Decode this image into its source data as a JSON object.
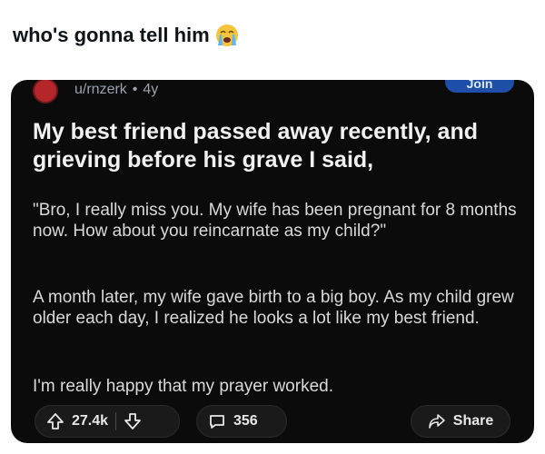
{
  "tweet": {
    "text": "who's gonna tell him",
    "emoji": "crying-face"
  },
  "post": {
    "author": "u/rnzerk",
    "separator": "•",
    "age": "4y",
    "join_label": "Join",
    "title": "My best friend passed away recently, and grieving before his grave I said,",
    "paragraphs": [
      "\"Bro, I really miss you. My wife has been pregnant for 8 months now. How about you reincarnate as my child?\"",
      "A month later, my wife gave birth to a big boy. As my child grew older each day, I realized he looks a lot like my best friend.",
      "I'm really happy that my prayer worked."
    ],
    "upvotes": "27.4k",
    "comments": "356",
    "share_label": "Share"
  },
  "colors": {
    "card_bg": "#0b0b0c",
    "join_bg": "#1f4fa8",
    "avatar": "#b5262b"
  }
}
